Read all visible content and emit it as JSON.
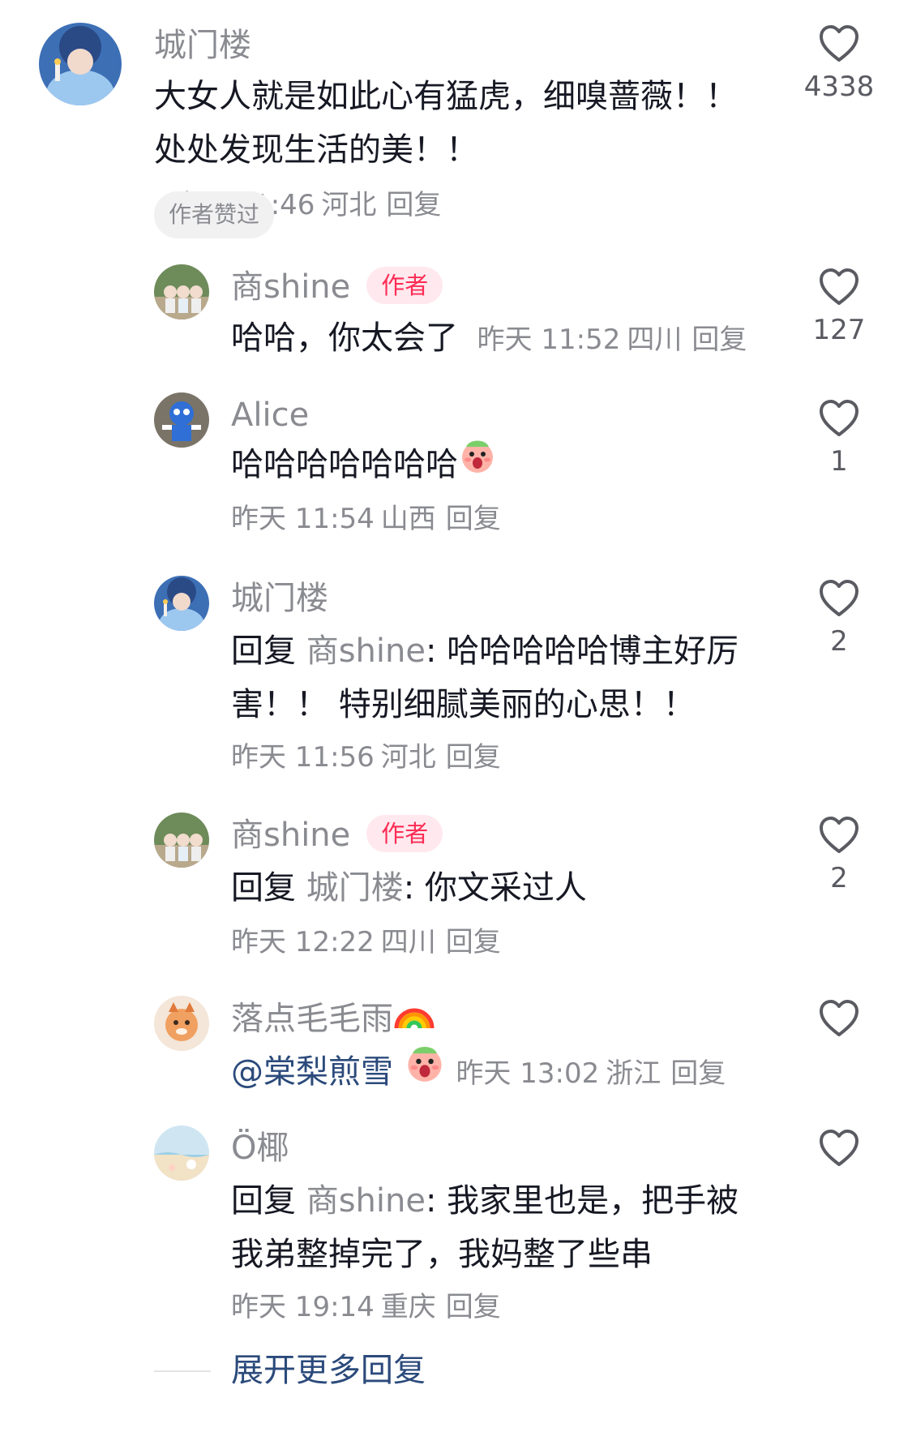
{
  "top_comment": {
    "username": "城门楼",
    "text": "大女人就是如此心有猛虎，细嗅蔷薇！！处处发现生活的美！！",
    "time": "昨天 11:46",
    "location": "河北",
    "reply_label": "回复",
    "likes": "4338",
    "liked_badge": "作者赞过"
  },
  "replies": [
    {
      "username": "商shine",
      "author_tag": "作者",
      "text": "哈哈，你太会了",
      "time": "昨天 11:52",
      "location": "四川",
      "reply_label": "回复",
      "likes": "127"
    },
    {
      "username": "Alice",
      "text": "哈哈哈哈哈哈哈",
      "emoji": "surprised-face-emoji",
      "time": "昨天 11:54",
      "location": "山西",
      "reply_label": "回复",
      "likes": "1"
    },
    {
      "username": "城门楼",
      "reply_prefix": "回复",
      "reply_to": "商shine",
      "text": ": 哈哈哈哈哈博主好厉害！！ 特别细腻美丽的心思！！",
      "time": "昨天 11:56",
      "location": "河北",
      "reply_label": "回复",
      "likes": "2"
    },
    {
      "username": "商shine",
      "author_tag": "作者",
      "reply_prefix": "回复",
      "reply_to": "城门楼",
      "text": ": 你文采过人",
      "time": "昨天 12:22",
      "location": "四川",
      "reply_label": "回复",
      "likes": "2"
    },
    {
      "username": "落点毛毛雨",
      "username_emoji": "rainbow-emoji",
      "mention": "@棠梨煎雪",
      "emoji": "surprised-face-emoji",
      "time": "昨天 13:02",
      "location": "浙江",
      "reply_label": "回复",
      "likes": ""
    },
    {
      "username": "Ö椰",
      "reply_prefix": "回复",
      "reply_to": "商shine",
      "text": ": 我家里也是，把手被我弟整掉完了，我妈整了些串",
      "time": "昨天 19:14",
      "location": "重庆",
      "reply_label": "回复",
      "likes": ""
    }
  ],
  "expand_more": "展开更多回复",
  "colors": {
    "accent_red": "#fe2c55",
    "link_blue": "#2b4a7b",
    "muted_gray": "#8a8b91"
  }
}
